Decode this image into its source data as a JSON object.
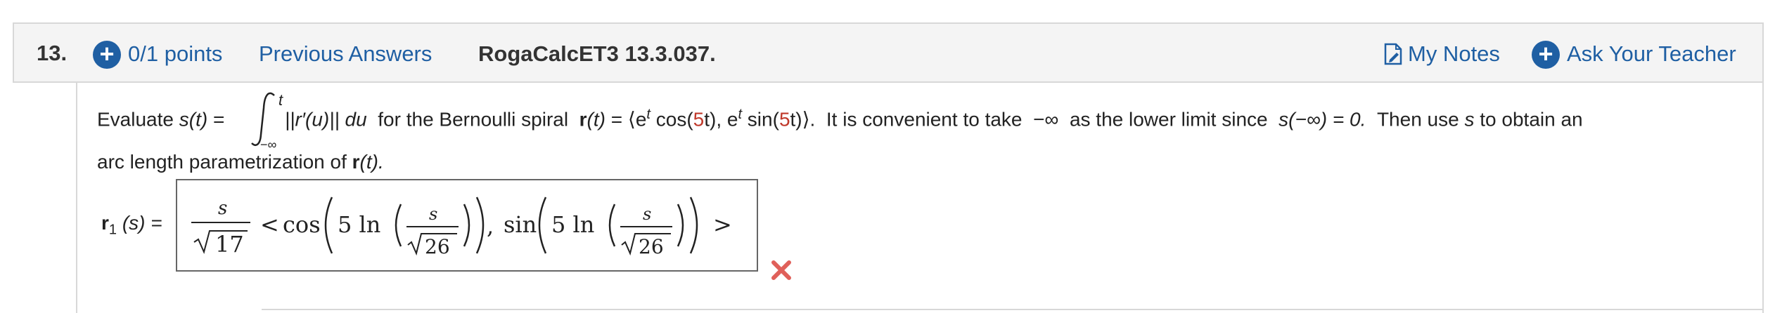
{
  "header": {
    "question_number": "13.",
    "points": "0/1 points",
    "previous_answers": "Previous Answers",
    "assignment_id": "RogaCalcET3 13.3.037.",
    "my_notes": "My Notes",
    "ask_teacher": "Ask Your Teacher"
  },
  "question": {
    "evaluate": "Evaluate",
    "s_of_t": "s(t)",
    "equals": "=",
    "integral_upper": "t",
    "integral_lower": "−∞",
    "integrand": "||r′(u)|| du",
    "for_the": "for the Bernoulli spiral",
    "r_label": "r",
    "r_arg": "(t)",
    "expr_open": "⟨e",
    "sup_t": "t",
    "cos_open": " cos(",
    "five": "5",
    "t_close_comma": "t), e",
    "sin_open": " sin(",
    "t_close_angle": "t)⟩.",
    "convenient": "It is convenient to take",
    "neg_inf": "−∞",
    "lower_limit": "as the lower limit since",
    "s_neg_inf": "s(−∞) = 0.",
    "then_use": "Then use",
    "s_var": "s",
    "to_obtain": "to obtain an",
    "line2_start": "arc length parametrization of",
    "line2_end": "(t)."
  },
  "answer": {
    "label_r": "r",
    "label_sub": "1",
    "label_rest": "(s) =",
    "frac1_num": "s",
    "sqrt17": "17",
    "lt": "<",
    "cos": "cos",
    "five_ln_1": "5 ln",
    "frac2_num": "s",
    "sqrt26_a": "26",
    "comma": ",",
    "sin": "sin",
    "five_ln_2": "5 ln",
    "frac3_num": "s",
    "sqrt26_b": "26",
    "gt": ">"
  },
  "colors": {
    "link": "#1f5fa3",
    "incorrect": "#e0605a",
    "highlight": "#c0392b"
  },
  "icons": [
    "plus-circle-icon",
    "notes-icon",
    "incorrect-x-icon"
  ]
}
